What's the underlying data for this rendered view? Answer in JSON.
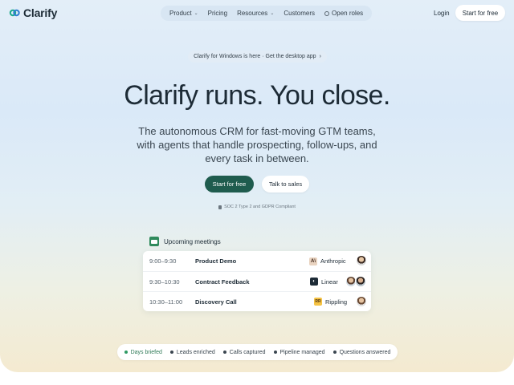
{
  "brand": {
    "name": "Clarify",
    "color": "#1aa98a"
  },
  "nav": {
    "items": [
      {
        "label": "Product",
        "dropdown": true
      },
      {
        "label": "Pricing",
        "dropdown": false
      },
      {
        "label": "Resources",
        "dropdown": true
      },
      {
        "label": "Customers",
        "dropdown": false
      },
      {
        "label": "Open roles",
        "dropdown": false,
        "icon": "circle-icon"
      }
    ],
    "login_label": "Login",
    "start_label": "Start for free"
  },
  "announcement": {
    "text": "Clarify for Windows is here · Get the desktop app",
    "arrow": "›"
  },
  "hero": {
    "headline": "Clarify runs. You close.",
    "subline": "The autonomous CRM for fast-moving GTM teams, with agents that handle prospecting, follow-ups, and every task in between.",
    "primary_cta": "Start for free",
    "secondary_cta": "Talk to sales",
    "compliance": "SOC 2 Type 2 and GDPR Compliant",
    "primary_color": "#1f5c4e"
  },
  "meetings": {
    "title": "Upcoming meetings",
    "rows": [
      {
        "time": "9:00–9:30",
        "name": "Product Demo",
        "company": "Anthropic",
        "logo": "A\\",
        "logo_bg": "#e9d3c0",
        "logo_fg": "#3a2418"
      },
      {
        "time": "9:30–10:30",
        "name": "Contract Feedback",
        "company": "Linear",
        "logo": "◐",
        "logo_bg": "#1d2b36",
        "logo_fg": "#ffffff"
      },
      {
        "time": "10:30–11:00",
        "name": "Discovery Call",
        "company": "Rippling",
        "logo": "RR",
        "logo_bg": "#f6c343",
        "logo_fg": "#4a2e10"
      }
    ]
  },
  "pills": [
    {
      "label": "Days briefed",
      "active": true
    },
    {
      "label": "Leads enriched",
      "active": false
    },
    {
      "label": "Calls captured",
      "active": false
    },
    {
      "label": "Pipeline managed",
      "active": false
    },
    {
      "label": "Questions answered",
      "active": false
    }
  ]
}
